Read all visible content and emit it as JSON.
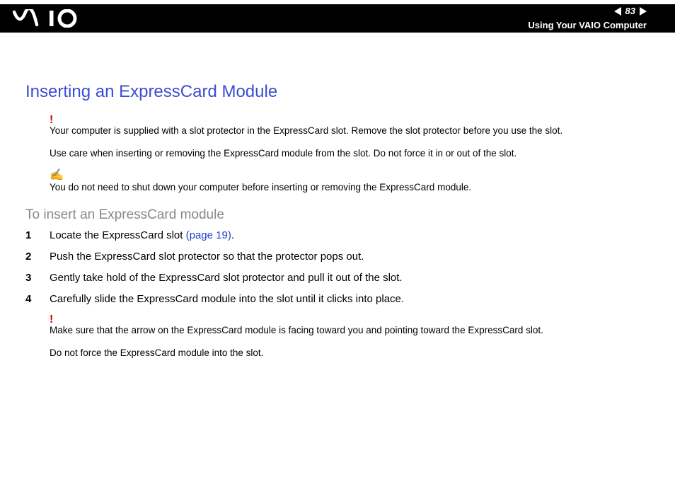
{
  "header": {
    "page_number": "83",
    "section_title": "Using Your VAIO Computer"
  },
  "page": {
    "title": "Inserting an ExpressCard Module",
    "warn1": "Your computer is supplied with a slot protector in the ExpressCard slot. Remove the slot protector before you use the slot.",
    "warn2": "Use care when inserting or removing the ExpressCard module from the slot. Do not force it in or out of the slot.",
    "note1": "You do not need to shut down your computer before inserting or removing the ExpressCard module.",
    "subheading": "To insert an ExpressCard module",
    "steps": {
      "s1a": "Locate the ExpressCard slot ",
      "s1_link": "(page 19)",
      "s1b": ".",
      "s2": "Push the ExpressCard slot protector so that the protector pops out.",
      "s3": "Gently take hold of the ExpressCard slot protector and pull it out of the slot.",
      "s4": "Carefully slide the ExpressCard module into the slot until it clicks into place."
    },
    "warn3": "Make sure that the arrow on the ExpressCard module is facing toward you and pointing toward the ExpressCard slot.",
    "warn4": "Do not force the ExpressCard module into the slot.",
    "nums": {
      "n1": "1",
      "n2": "2",
      "n3": "3",
      "n4": "4"
    },
    "bang": "!",
    "note_glyph": "✍"
  }
}
